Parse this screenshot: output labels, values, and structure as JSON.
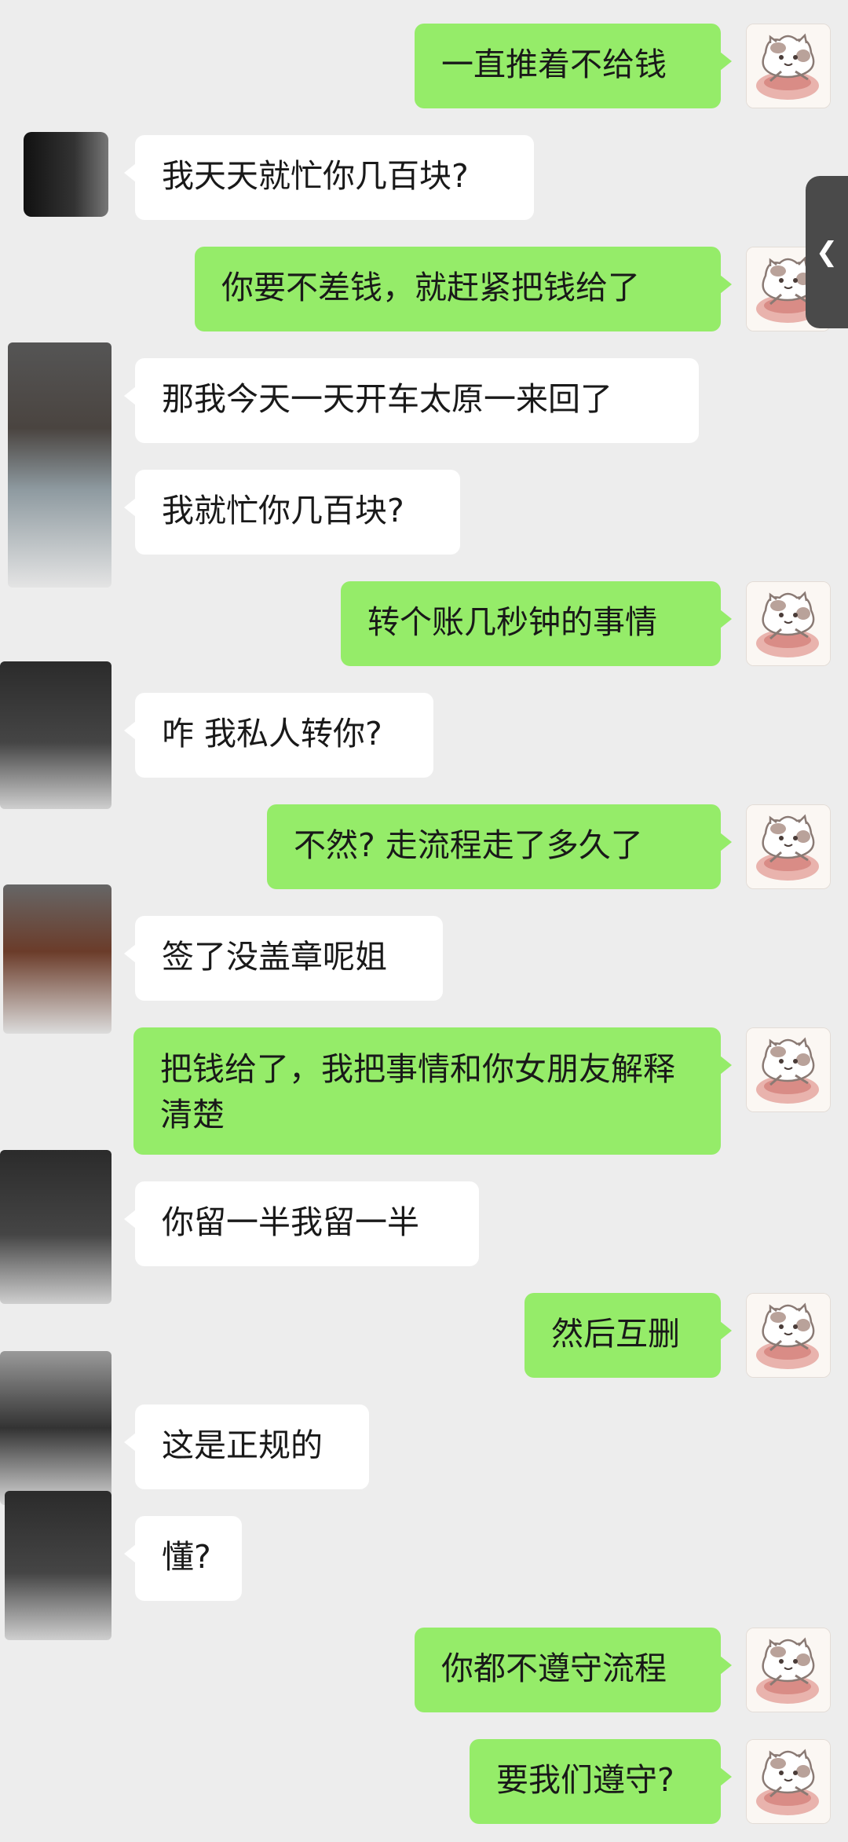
{
  "side_tab_icon": "chevron-left-icon",
  "messages": [
    {
      "from": "me",
      "text": "一直推着不给钱"
    },
    {
      "from": "them",
      "text": "我天天就忙你几百块?"
    },
    {
      "from": "me",
      "text": "你要不差钱，就赶紧把钱给了"
    },
    {
      "from": "them",
      "text": "那我今天一天开车太原一来回了"
    },
    {
      "from": "them",
      "text": "我就忙你几百块?"
    },
    {
      "from": "me",
      "text": "转个账几秒钟的事情"
    },
    {
      "from": "them",
      "text": "咋 我私人转你?"
    },
    {
      "from": "me",
      "text": "不然? 走流程走了多久了"
    },
    {
      "from": "them",
      "text": "签了没盖章呢姐"
    },
    {
      "from": "me",
      "text": "把钱给了，我把事情和你女朋友解释清楚"
    },
    {
      "from": "them",
      "text": "你留一半我留一半"
    },
    {
      "from": "me",
      "text": "然后互删"
    },
    {
      "from": "them",
      "text": "这是正规的"
    },
    {
      "from": "them",
      "text": "懂?"
    },
    {
      "from": "me",
      "text": "你都不遵守流程"
    },
    {
      "from": "me",
      "text": "要我们遵守?"
    }
  ]
}
